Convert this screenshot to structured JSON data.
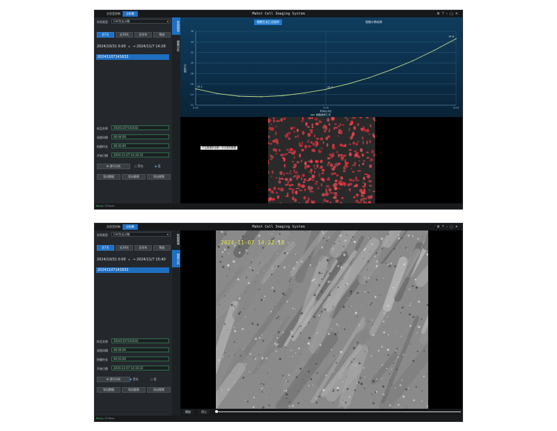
{
  "windows": [
    {
      "app_title": "Mahot Cell Imaging System",
      "tabs": [
        "实验室控制",
        "分析数"
      ],
      "active_tab": 1,
      "sidebar": {
        "experiment_type_label": "实验类型",
        "experiment_type_value": "Cell生长计数",
        "range_buttons": [
          "近7天",
          "近30天",
          "近半年",
          "筛选"
        ],
        "date_from": "2024/10/31 0:00",
        "date_to": "2024/11/7 14:28",
        "records": [
          "20241107141632"
        ],
        "info": [
          {
            "label": "样品名称",
            "value": "20241107141632"
          },
          {
            "label": "采图间隔",
            "value": "00:04:00"
          },
          {
            "label": "拍摄时长",
            "value": "00:03:00"
          },
          {
            "label": "开始日期",
            "value": "2024-11-07 14:16:32"
          }
        ],
        "analysis_button": "进行分析",
        "radio_options": [
          "荧光",
          "否"
        ],
        "radio_selected": 1,
        "actions": [
          "导出数据",
          "导出图表",
          "导出视频"
        ]
      },
      "vertical_tabs": [
        "数据图表",
        "细胞分析"
      ],
      "vertical_active": 0,
      "chart_tabs": [
        "细胞生长汇总面积",
        "细胞计数结果"
      ],
      "chart_active": 0,
      "status": {
        "state": "Ready",
        "text": "1725um"
      },
      "tooltip": "产生数据来自第一次记录的数据",
      "chart_data": {
        "type": "line",
        "x": [
          0.0,
          0.5,
          1.0,
          1.5,
          2.0,
          2.5,
          3.0,
          3.5,
          4.0,
          4.5,
          5.0,
          5.5,
          6.0
        ],
        "series": [
          {
            "name": "细胞面积汇总",
            "values": [
              25.1,
              24.2,
              23.7,
              23.6,
              23.8,
              24.3,
              25.0,
              26.0,
              27.2,
              28.7,
              30.4,
              32.4,
              34.6
            ]
          }
        ],
        "point_labels": [
          {
            "x": 0.0,
            "label": "25.1"
          },
          {
            "x": 3.0,
            "label": "25.0"
          },
          {
            "x": 6.0,
            "label": "34.6"
          }
        ],
        "xlabel": "时间(小时)",
        "ylabel": "面积(%)",
        "xlim": [
          0,
          6
        ],
        "ylim": [
          22,
          36
        ],
        "xticks": [
          "0.00",
          "3.00",
          "6.00"
        ],
        "yticks": [
          "22",
          "24",
          "26",
          "28",
          "30",
          "32",
          "34",
          "36"
        ],
        "grid": true,
        "legend_position": "bottom-center",
        "line_color": "#c6e08a",
        "bg_color": "#0e3a5a"
      }
    },
    {
      "app_title": "Mahot Cell Imaging System",
      "tabs": [
        "实验室控制",
        "分析数"
      ],
      "active_tab": 1,
      "sidebar": {
        "experiment_type_label": "实验类型",
        "experiment_type_value": "Cell生长计数",
        "range_buttons": [
          "近7天",
          "近30天",
          "近半年",
          "筛选"
        ],
        "date_from": "2024/10/31 0:00",
        "date_to": "2024/11/7 15:40",
        "records": [
          "20241107141632"
        ],
        "info": [
          {
            "label": "样品名称",
            "value": "20241107141632"
          },
          {
            "label": "采图间隔",
            "value": "00:04:00"
          },
          {
            "label": "拍摄时长",
            "value": "00:03:00"
          },
          {
            "label": "开始日期",
            "value": "2024-11-07 14:16:32"
          }
        ],
        "analysis_button": "进行分析",
        "radio_options": [
          "荧光",
          "否"
        ],
        "radio_selected": 0,
        "actions": [
          "导出数据",
          "导出图表",
          "导出视频"
        ]
      },
      "vertical_tabs": [
        "数据图表",
        "细胞分析"
      ],
      "vertical_active": 1,
      "image_timestamp": "2024-11-07 14:22:18",
      "playback": {
        "play_label": "播放",
        "pause_label": "停止",
        "progress": 0.0
      },
      "status": {
        "state": "Ready",
        "text": "1725um"
      }
    }
  ]
}
